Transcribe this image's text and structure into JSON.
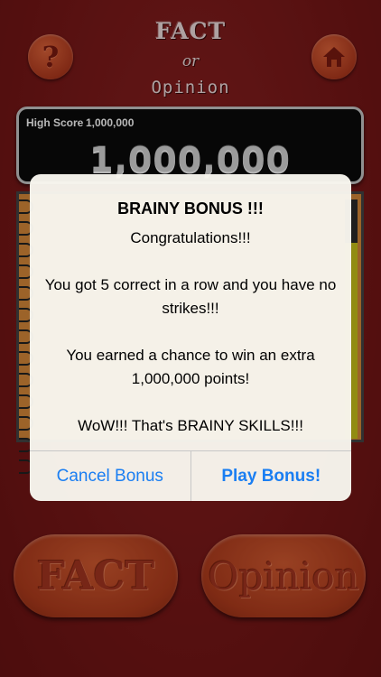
{
  "logo": {
    "line1": "FACT",
    "line2": "or",
    "line3": "Opinion"
  },
  "icons": {
    "help": "question-mark-icon",
    "home": "home-icon"
  },
  "score": {
    "high_score_label": "High Score",
    "high_score_value": "1,000,000",
    "current": "1,000,000"
  },
  "answers": {
    "fact": "FACT",
    "opinion": "Opinion"
  },
  "alert": {
    "title": "BRAINY BONUS !!!",
    "line1": "Congratulations!!!",
    "line2": "You got 5 correct in a row and you have no strikes!!!",
    "line3": "You earned a chance to win an extra 1,000,000 points!",
    "line4": "WoW!!! That's BRAINY SKILLS!!!",
    "cancel": "Cancel Bonus",
    "play": "Play Bonus!"
  },
  "colors": {
    "background": "#7d1a1a",
    "alert_button": "#1a7ef2",
    "button_orange": "#c2461f"
  }
}
